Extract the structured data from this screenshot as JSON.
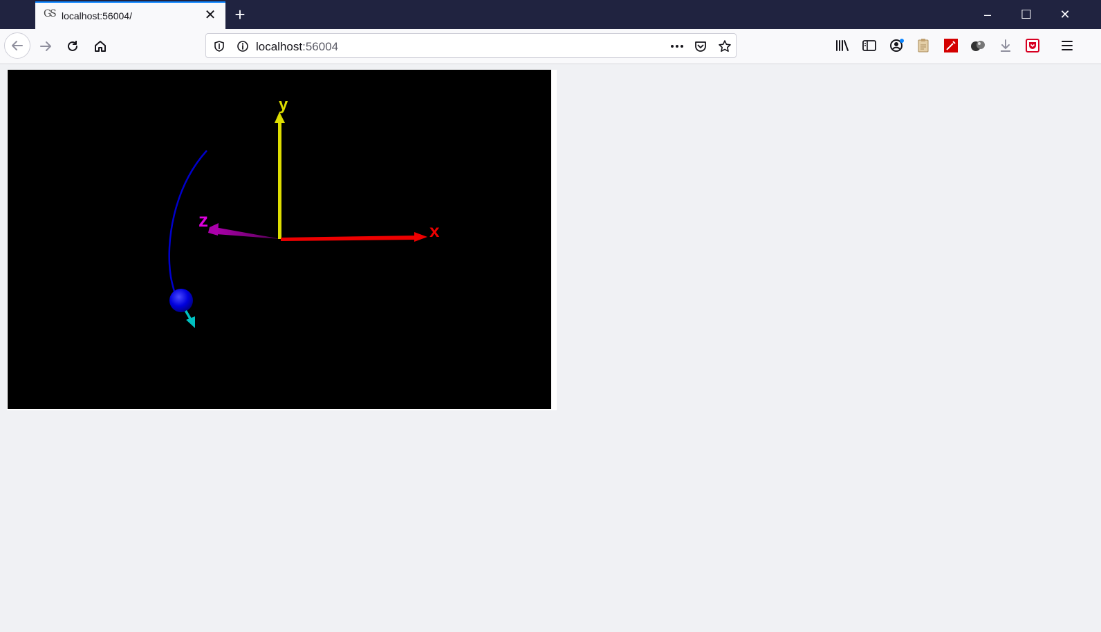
{
  "browser": {
    "tab": {
      "title": "localhost:56004/",
      "favicon_text": "GS"
    },
    "url": {
      "host": "localhost",
      "port": ":56004"
    },
    "icons": {
      "back": "back-arrow-icon",
      "forward": "forward-arrow-icon",
      "reload": "reload-icon",
      "home": "home-icon",
      "shield": "tracking-protection-shield-icon",
      "info": "site-info-icon",
      "more": "page-actions-ellipsis-icon",
      "pocket": "pocket-icon",
      "bookmark": "bookmark-star-icon",
      "library": "library-icon",
      "sidebar": "sidebar-icon",
      "account": "account-icon",
      "ext1": "clipboard-extension-icon",
      "ext2": "color-picker-extension-icon",
      "ext3": "cookie-extension-icon",
      "downloads": "download-arrow-icon",
      "ext4": "pocket-red-extension-icon",
      "menu": "hamburger-menu-icon"
    },
    "window_controls": {
      "minimize": "–",
      "maximize": "☐",
      "close": "✕"
    }
  },
  "scene": {
    "background": "#000000",
    "axes": [
      {
        "label": "x",
        "color": "#ee0000"
      },
      {
        "label": "y",
        "color": "#dddd00"
      },
      {
        "label": "z",
        "color": "#dd00dd"
      }
    ],
    "sphere_color": "#0000ee",
    "trail_color": "#0000cc",
    "velocity_arrow_color": "#00c0c0"
  }
}
